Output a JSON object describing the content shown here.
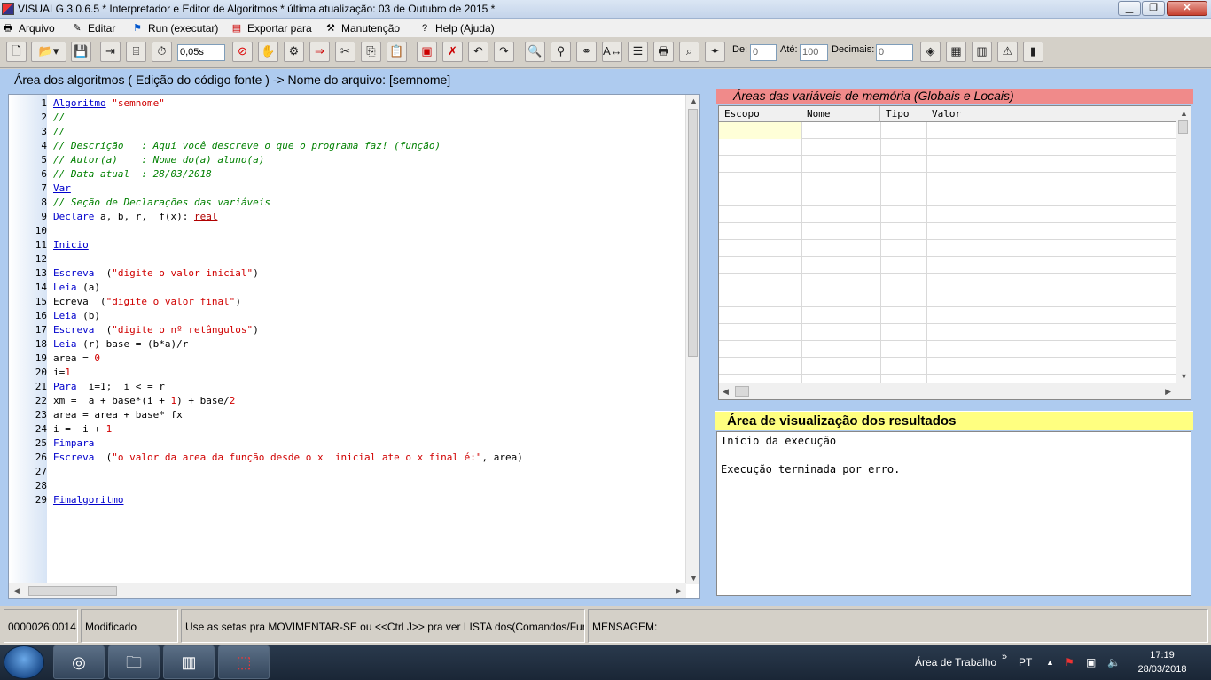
{
  "window": {
    "title": "VISUALG 3.0.6.5 * Interpretador e Editor de Algoritmos * última atualização: 03 de Outubro de 2015 *",
    "min": "▁",
    "max": "❐",
    "close": "✕"
  },
  "menu": [
    {
      "label": "Arquivo",
      "icon": "printer-icon"
    },
    {
      "label": "Editar",
      "icon": "edit-icon"
    },
    {
      "label": "Run (executar)",
      "icon": "run-icon"
    },
    {
      "label": "Exportar para",
      "icon": "export-icon"
    },
    {
      "label": "Manutenção",
      "icon": "tools-icon"
    },
    {
      "label": "Help (Ajuda)",
      "icon": "help-icon"
    }
  ],
  "toolbar": {
    "speed": "0,05s",
    "de_label": "De:",
    "de_value": "0",
    "ate_label": "Até:",
    "ate_value": "100",
    "decimais_label": "Decimais:",
    "decimais_value": "0"
  },
  "editor": {
    "title": "Área dos algoritmos ( Edição do código fonte ) -> Nome do arquivo: [semnome]"
  },
  "vars": {
    "title": "Áreas das variáveis de memória (Globais e Locais)",
    "columns": [
      "Escopo",
      "Nome",
      "Tipo",
      "Valor"
    ]
  },
  "results": {
    "title": "Área de visualização dos resultados",
    "lines": [
      "Início da execução",
      "",
      "Execução terminada por erro."
    ]
  },
  "status": {
    "position": "0000026:0014",
    "state": "Modificado",
    "hint": "Use as setas pra MOVIMENTAR-SE ou <<Ctrl J>> pra ver LISTA dos(Comandos/Funçõ",
    "message": "MENSAGEM:"
  },
  "taskbar": {
    "desktop": "Área de Trabalho",
    "lang": "PT",
    "time": "17:19",
    "date": "28/03/2018"
  },
  "code": [
    [
      [
        "kw",
        "Algoritmo"
      ],
      [
        "",
        ""
      ],
      [
        "st",
        " \"semnome\""
      ]
    ],
    [
      [
        "cm",
        "//"
      ]
    ],
    [
      [
        "cm",
        "//"
      ]
    ],
    [
      [
        "cm",
        "// Descrição   : Aqui você descreve o que o programa faz! (função)"
      ]
    ],
    [
      [
        "cm",
        "// Autor(a)    : Nome do(a) aluno(a)"
      ]
    ],
    [
      [
        "cm",
        "// Data atual  : 28/03/2018"
      ]
    ],
    [
      [
        "kw",
        "Var"
      ]
    ],
    [
      [
        "cm",
        "// Seção de Declarações das variáveis"
      ]
    ],
    [
      [
        "kw2",
        "Declare"
      ],
      [
        "",
        " a, b, r,  f(x): "
      ],
      [
        "ty",
        "real"
      ]
    ],
    [],
    [
      [
        "kw",
        "Inicio"
      ]
    ],
    [],
    [
      [
        "kw2",
        "Escreva"
      ],
      [
        "",
        "  ("
      ],
      [
        "st",
        "\"digite o valor inicial\""
      ],
      [
        "",
        ")"
      ]
    ],
    [
      [
        "kw2",
        "Leia"
      ],
      [
        "",
        " (a)"
      ]
    ],
    [
      [
        "",
        "Ecreva  ("
      ],
      [
        "st",
        "\"digite o valor final\""
      ],
      [
        "",
        ")"
      ]
    ],
    [
      [
        "kw2",
        "Leia"
      ],
      [
        "",
        " (b)"
      ]
    ],
    [
      [
        "kw2",
        "Escreva"
      ],
      [
        "",
        "  ("
      ],
      [
        "st",
        "\"digite o nº retângulos\""
      ],
      [
        "",
        ")"
      ]
    ],
    [
      [
        "kw2",
        "Leia"
      ],
      [
        "",
        " (r) base = (b*a)/r"
      ]
    ],
    [
      [
        "",
        "area = "
      ],
      [
        "nm",
        "0"
      ]
    ],
    [
      [
        "",
        "i="
      ],
      [
        "nm",
        "1"
      ]
    ],
    [
      [
        "kw2",
        "Para"
      ],
      [
        "",
        "  i=1;  i < = r"
      ]
    ],
    [
      [
        "",
        "xm =  a + base*(i + "
      ],
      [
        "nm",
        "1"
      ],
      [
        "",
        ") + base/"
      ],
      [
        "nm",
        "2"
      ]
    ],
    [
      [
        "",
        "area = area + base* fx"
      ]
    ],
    [
      [
        "",
        "i =  i + "
      ],
      [
        "nm",
        "1"
      ]
    ],
    [
      [
        "kw2",
        "Fimpara"
      ]
    ],
    [
      [
        "kw2",
        "Escreva"
      ],
      [
        "",
        "  ("
      ],
      [
        "st",
        "\"o valor da area da função desde o x  inicial ate o x final é:\""
      ],
      [
        "",
        ", area)"
      ]
    ],
    [],
    [],
    [
      [
        "kw",
        "Fimalgoritmo"
      ]
    ]
  ]
}
